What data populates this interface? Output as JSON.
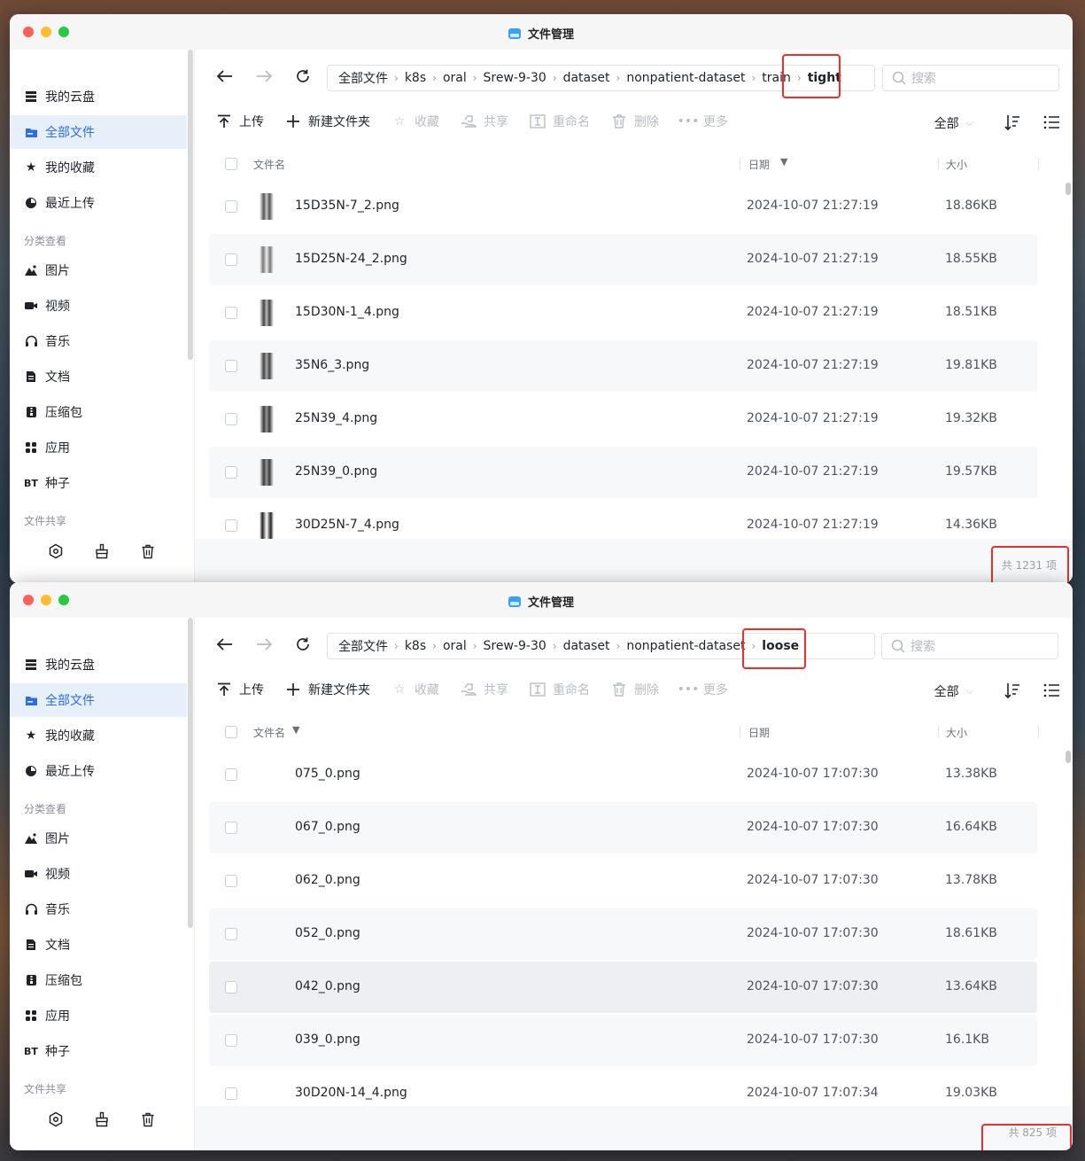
{
  "windows": [
    {
      "title": "文件管理",
      "sidebar": {
        "items": [
          {
            "label": "我的云盘"
          },
          {
            "label": "全部文件"
          },
          {
            "label": "我的收藏"
          },
          {
            "label": "最近上传"
          }
        ],
        "category_label": "分类查看",
        "categories": [
          {
            "label": "图片"
          },
          {
            "label": "视频"
          },
          {
            "label": "音乐"
          },
          {
            "label": "文档"
          },
          {
            "label": "压缩包"
          },
          {
            "label": "应用"
          },
          {
            "label": "种子",
            "badge": "BT"
          }
        ],
        "share_label": "文件共享"
      },
      "breadcrumb": [
        "全部文件",
        "k8s",
        "oral",
        "Srew-9-30",
        "dataset",
        "nonpatient-dataset",
        "train",
        "tight"
      ],
      "search_placeholder": "搜索",
      "toolbar": {
        "upload": "上传",
        "new_folder": "新建文件夹",
        "favorite": "收藏",
        "share": "共享",
        "rename": "重命名",
        "delete": "删除",
        "more": "更多"
      },
      "filter_label": "全部",
      "columns": {
        "name": "文件名",
        "date": "日期",
        "size": "大小"
      },
      "rows": [
        {
          "name": "15D35N-7_2.png",
          "date": "2024-10-07 21:27:19",
          "size": "18.86KB"
        },
        {
          "name": "15D25N-24_2.png",
          "date": "2024-10-07 21:27:19",
          "size": "18.55KB"
        },
        {
          "name": "15D30N-1_4.png",
          "date": "2024-10-07 21:27:19",
          "size": "18.51KB"
        },
        {
          "name": "35N6_3.png",
          "date": "2024-10-07 21:27:19",
          "size": "19.81KB"
        },
        {
          "name": "25N39_4.png",
          "date": "2024-10-07 21:27:19",
          "size": "19.32KB"
        },
        {
          "name": "25N39_0.png",
          "date": "2024-10-07 21:27:19",
          "size": "19.57KB"
        },
        {
          "name": "30D25N-7_4.png",
          "date": "2024-10-07 21:27:19",
          "size": "14.36KB"
        }
      ],
      "count_text": "共 1231 项",
      "sort_column": "date"
    },
    {
      "title": "文件管理",
      "sidebar": {
        "items": [
          {
            "label": "我的云盘"
          },
          {
            "label": "全部文件"
          },
          {
            "label": "我的收藏"
          },
          {
            "label": "最近上传"
          }
        ],
        "category_label": "分类查看",
        "categories": [
          {
            "label": "图片"
          },
          {
            "label": "视频"
          },
          {
            "label": "音乐"
          },
          {
            "label": "文档"
          },
          {
            "label": "压缩包"
          },
          {
            "label": "应用"
          },
          {
            "label": "种子",
            "badge": "BT"
          }
        ],
        "share_label": "文件共享"
      },
      "breadcrumb": [
        "全部文件",
        "k8s",
        "oral",
        "Srew-9-30",
        "dataset",
        "nonpatient-dataset",
        "loose"
      ],
      "search_placeholder": "搜索",
      "toolbar": {
        "upload": "上传",
        "new_folder": "新建文件夹",
        "favorite": "收藏",
        "share": "共享",
        "rename": "重命名",
        "delete": "删除",
        "more": "更多"
      },
      "filter_label": "全部",
      "columns": {
        "name": "文件名",
        "date": "日期",
        "size": "大小"
      },
      "rows": [
        {
          "name": "075_0.png",
          "date": "2024-10-07 17:07:30",
          "size": "13.38KB"
        },
        {
          "name": "067_0.png",
          "date": "2024-10-07 17:07:30",
          "size": "16.64KB"
        },
        {
          "name": "062_0.png",
          "date": "2024-10-07 17:07:30",
          "size": "13.78KB"
        },
        {
          "name": "052_0.png",
          "date": "2024-10-07 17:07:30",
          "size": "18.61KB"
        },
        {
          "name": "042_0.png",
          "date": "2024-10-07 17:07:30",
          "size": "13.64KB"
        },
        {
          "name": "039_0.png",
          "date": "2024-10-07 17:07:30",
          "size": "16.1KB"
        },
        {
          "name": "30D20N-14_4.png",
          "date": "2024-10-07 17:07:34",
          "size": "19.03KB"
        }
      ],
      "count_text": "共 825 项",
      "sort_column": "name"
    }
  ],
  "colors": {
    "accent": "#2c6ce8",
    "highlight_box": "#e8312e",
    "active_bg": "#e7effb"
  }
}
